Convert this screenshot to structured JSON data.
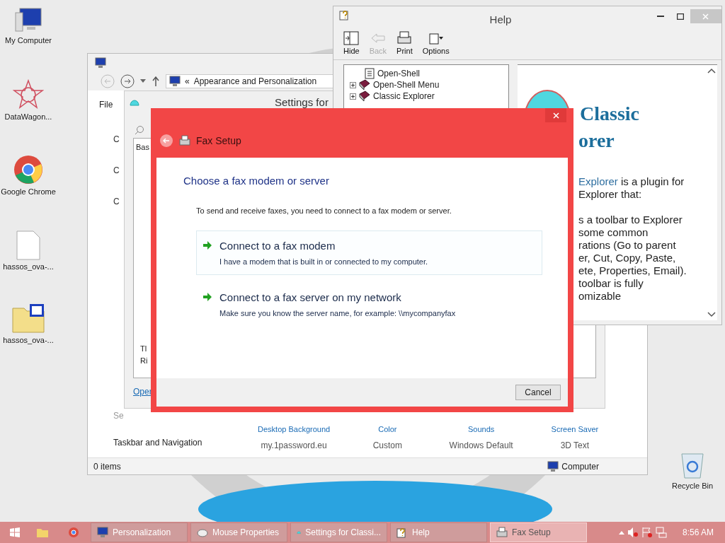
{
  "desktop_icons": [
    {
      "label": "My Computer",
      "kind": "computer"
    },
    {
      "label": "DataWagon...",
      "kind": "star"
    },
    {
      "label": "Google Chrome",
      "kind": "chrome"
    },
    {
      "label": "hassos_ova-...",
      "kind": "file"
    },
    {
      "label": "hassos_ova-...",
      "kind": "archive"
    },
    {
      "label": "Recycle Bin",
      "kind": "bin"
    }
  ],
  "personalization": {
    "breadcrumb_sep": "«",
    "breadcrumb": "Appearance and Personalization",
    "menu": "File",
    "left_fragments": [
      "C",
      "C",
      "C"
    ],
    "section_fragment": "Se",
    "taskbar_link": "Taskbar and Navigation",
    "settings": [
      {
        "label": "Desktop Background",
        "value": "my.1password.eu"
      },
      {
        "label": "Color",
        "value": "Custom"
      },
      {
        "label": "Sounds",
        "value": "Windows Default"
      },
      {
        "label": "Screen Saver",
        "value": "3D Text"
      }
    ],
    "status_left": "0 items",
    "status_right": "Computer"
  },
  "settings_window": {
    "title": "Settings for",
    "tab_fragment": "Bas",
    "text_fragments": [
      "Tl",
      "Ri"
    ],
    "link_fragment": "Oper"
  },
  "help": {
    "title": "Help",
    "toolbar": [
      {
        "label": "Hide",
        "disabled": false,
        "kind": "hide"
      },
      {
        "label": "Back",
        "disabled": true,
        "kind": "back"
      },
      {
        "label": "Print",
        "disabled": false,
        "kind": "print"
      },
      {
        "label": "Options",
        "disabled": false,
        "kind": "options"
      }
    ],
    "tree": [
      {
        "label": "Open-Shell",
        "kind": "page"
      },
      {
        "label": "Open-Shell Menu",
        "kind": "book"
      },
      {
        "label": "Classic Explorer",
        "kind": "book"
      }
    ],
    "heading": [
      "Classic",
      "orer"
    ],
    "paragraph_lead": "Explorer",
    "lines": [
      " is a plugin for",
      "Explorer that:"
    ],
    "lines_2": [
      "s a toolbar to Explorer",
      "some common",
      "rations (Go to parent",
      "er, Cut, Copy, Paste,",
      "ete, Properties, Email).",
      "toolbar is fully",
      "omizable"
    ]
  },
  "fax": {
    "title": "Fax Setup",
    "heading": "Choose a fax modem or server",
    "intro": "To send and receive faxes, you need to connect to a fax modem or server.",
    "options": [
      {
        "title": "Connect to a fax modem",
        "description": "I have a modem that is built in or connected to my computer.",
        "highlighted": true
      },
      {
        "title": "Connect to a fax server on my network",
        "description": "Make sure you know the server name, for example: \\\\mycompanyfax",
        "highlighted": false
      }
    ],
    "cancel": "Cancel"
  },
  "taskbar": {
    "items": [
      {
        "label": "Personalization",
        "kind": "monitor",
        "selected": false
      },
      {
        "label": "Mouse Properties",
        "kind": "mouse",
        "selected": false
      },
      {
        "label": "Settings for Classi...",
        "kind": "shell",
        "selected": false
      },
      {
        "label": "Help",
        "kind": "help",
        "selected": false
      },
      {
        "label": "Fax Setup",
        "kind": "fax",
        "selected": true
      }
    ],
    "clock": "8:56 AM"
  }
}
